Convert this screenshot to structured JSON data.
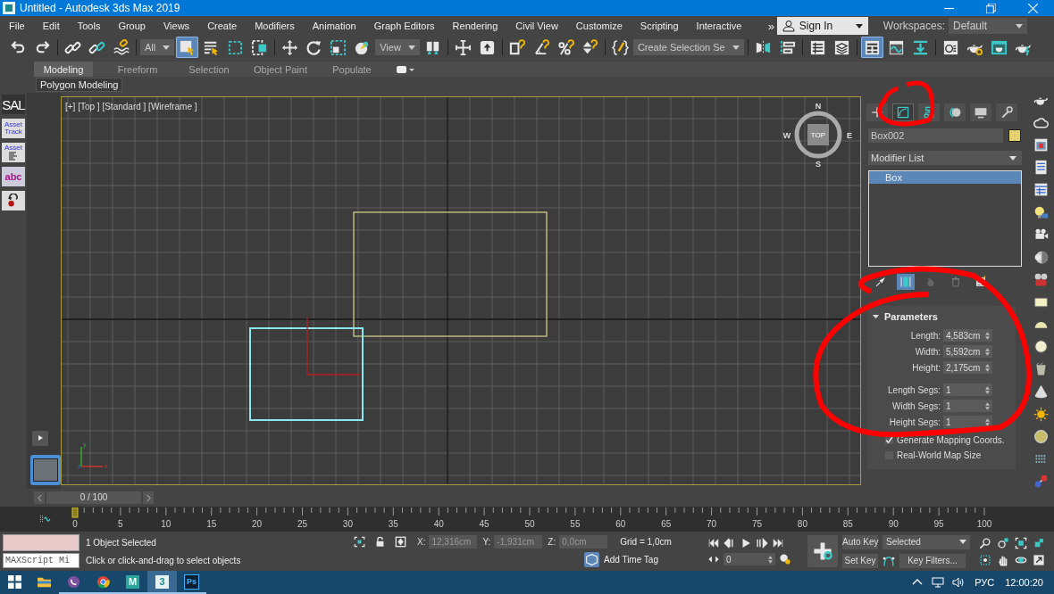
{
  "window": {
    "title": "Untitled - Autodesk 3ds Max 2019"
  },
  "menu": [
    "File",
    "Edit",
    "Tools",
    "Group",
    "Views",
    "Create",
    "Modifiers",
    "Animation",
    "Graph Editors",
    "Rendering",
    "Civil View",
    "Customize",
    "Scripting",
    "Interactive"
  ],
  "account": {
    "overflow": "»",
    "label": "Sign In"
  },
  "workspaces": {
    "label": "Workspaces:",
    "value": "Default"
  },
  "toolbar": [
    {
      "kind": "undo",
      "selected": false
    },
    {
      "kind": "redo",
      "selected": false
    },
    {
      "kind": "separator"
    },
    {
      "kind": "link",
      "selected": false
    },
    {
      "kind": "unlink",
      "selected": false
    },
    {
      "kind": "bind",
      "selected": false
    },
    {
      "kind": "separator"
    },
    {
      "kind": "dropdown",
      "value": "All"
    },
    {
      "kind": "select",
      "selected": true
    },
    {
      "kind": "selname",
      "selected": false
    },
    {
      "kind": "rectsel",
      "selected": false
    },
    {
      "kind": "window",
      "selected": false
    },
    {
      "kind": "separator"
    },
    {
      "kind": "move",
      "selected": false
    },
    {
      "kind": "rotate",
      "selected": false
    },
    {
      "kind": "scale",
      "selected": false
    },
    {
      "kind": "place",
      "selected": false
    },
    {
      "kind": "dropdown",
      "value": "View"
    },
    {
      "kind": "pivot",
      "selected": false
    },
    {
      "kind": "separator"
    },
    {
      "kind": "cross",
      "selected": false
    },
    {
      "kind": "upbox",
      "selected": false
    },
    {
      "kind": "separator"
    },
    {
      "kind": "snap",
      "selected": false
    },
    {
      "kind": "angle",
      "selected": false
    },
    {
      "kind": "percent",
      "selected": false
    },
    {
      "kind": "spinner",
      "selected": false
    },
    {
      "kind": "separator"
    },
    {
      "kind": "editnamed",
      "selected": false
    },
    {
      "kind": "dropdown",
      "value": "Create Selection Se"
    },
    {
      "kind": "separator"
    },
    {
      "kind": "mirror",
      "selected": false
    },
    {
      "kind": "align",
      "selected": false
    },
    {
      "kind": "separator"
    },
    {
      "kind": "explorer",
      "selected": false
    },
    {
      "kind": "layers",
      "selected": false
    },
    {
      "kind": "separator"
    },
    {
      "kind": "ribbon",
      "selected": true
    },
    {
      "kind": "curve",
      "selected": false
    },
    {
      "kind": "dope",
      "selected": false
    },
    {
      "kind": "separator"
    },
    {
      "kind": "rsetup",
      "selected": false
    },
    {
      "kind": "rendergear",
      "selected": false
    },
    {
      "kind": "rframe",
      "selected": false
    },
    {
      "kind": "renderq",
      "selected": false
    }
  ],
  "ribbon": {
    "tabs": [
      {
        "label": "Modeling",
        "selected": true
      },
      {
        "label": "Freeform",
        "selected": false
      },
      {
        "label": "Selection",
        "selected": false
      },
      {
        "label": "Object Paint",
        "selected": false
      },
      {
        "label": "Populate",
        "selected": false
      }
    ],
    "panel": "Polygon Modeling"
  },
  "left_toolbar": [
    {
      "kind": "text",
      "label": "SAL"
    },
    {
      "kind": "badge",
      "label": "Asset Track"
    },
    {
      "kind": "list",
      "label": "Asset"
    },
    {
      "kind": "badge",
      "label": "abc"
    },
    {
      "kind": "undo"
    }
  ],
  "viewport": {
    "label": "[+] [Top ] [Standard ] [Wireframe ]",
    "compass": {
      "north": "N",
      "west": "W",
      "cube": "TOP",
      "east": "E",
      "south": "S"
    },
    "axes": {
      "x": "x",
      "y": "y",
      "z": "z"
    }
  },
  "command_panel": {
    "tabs": [
      {
        "kind": "create",
        "selected": false
      },
      {
        "kind": "modify",
        "selected": true
      },
      {
        "kind": "hierarchy",
        "selected": false
      },
      {
        "kind": "motion",
        "selected": false
      },
      {
        "kind": "display",
        "selected": false
      },
      {
        "kind": "utilities",
        "selected": false
      }
    ],
    "object_name": "Box002",
    "modifier_list": "Modifier List",
    "stack": [
      {
        "label": "Box",
        "selected": true
      }
    ],
    "stack_tools": [
      {
        "kind": "pin",
        "selected": false
      },
      {
        "kind": "result",
        "selected": true
      },
      {
        "kind": "unique",
        "selected": false
      },
      {
        "kind": "remove",
        "selected": false
      },
      {
        "kind": "configure",
        "selected": false
      }
    ],
    "rollout": {
      "title": "Parameters",
      "expanded": true,
      "fields": [
        {
          "label": "Length:",
          "value": "4,583cm"
        },
        {
          "label": "Width:",
          "value": "5,592cm"
        },
        {
          "label": "Height:",
          "value": "2,175cm"
        },
        {
          "label": "Length Segs:",
          "value": "1"
        },
        {
          "label": "Width Segs:",
          "value": "1"
        },
        {
          "label": "Height Segs:",
          "value": "1"
        }
      ],
      "checkboxes": [
        {
          "label": "Generate Mapping Coords.",
          "checked": true
        },
        {
          "label": "Real-World Map Size",
          "checked": false
        }
      ]
    }
  },
  "timeline": {
    "frame": "0 / 100",
    "ticks": [
      "0",
      "5",
      "10",
      "15",
      "20",
      "25",
      "30",
      "35",
      "40",
      "45",
      "50",
      "55",
      "60",
      "65",
      "70",
      "75",
      "80",
      "85",
      "90",
      "95",
      "100"
    ]
  },
  "status": {
    "maxscript": {
      "placeholder": "MAXScript Mi"
    },
    "selection": "1 Object Selected",
    "prompt": "Click or click-and-drag to select objects",
    "x_label": "X:",
    "x": "12,316cm",
    "y_label": "Y:",
    "y": "-1,931cm",
    "z_label": "Z:",
    "z": "0,0cm",
    "grid": "Grid = 1,0cm",
    "time_tag": "Add Time Tag",
    "current_frame": "0",
    "auto_key": "Auto Key",
    "set_key": "Set Key",
    "key_mode": "Selected",
    "key_filters": "Key Filters..."
  },
  "taskbar": {
    "apps": [
      {
        "kind": "start",
        "running": false,
        "selected": false
      },
      {
        "kind": "folder",
        "running": false,
        "selected": false
      },
      {
        "kind": "viber",
        "running": true,
        "selected": false
      },
      {
        "kind": "chrome",
        "running": true,
        "selected": false
      },
      {
        "kind": "letter",
        "label": "M",
        "running": true,
        "selected": false
      },
      {
        "kind": "max",
        "label": "3",
        "running": true,
        "selected": true
      },
      {
        "kind": "ps",
        "label": "Ps",
        "running": true,
        "selected": false
      }
    ],
    "language": "РУС",
    "clock": "12:00:20"
  }
}
